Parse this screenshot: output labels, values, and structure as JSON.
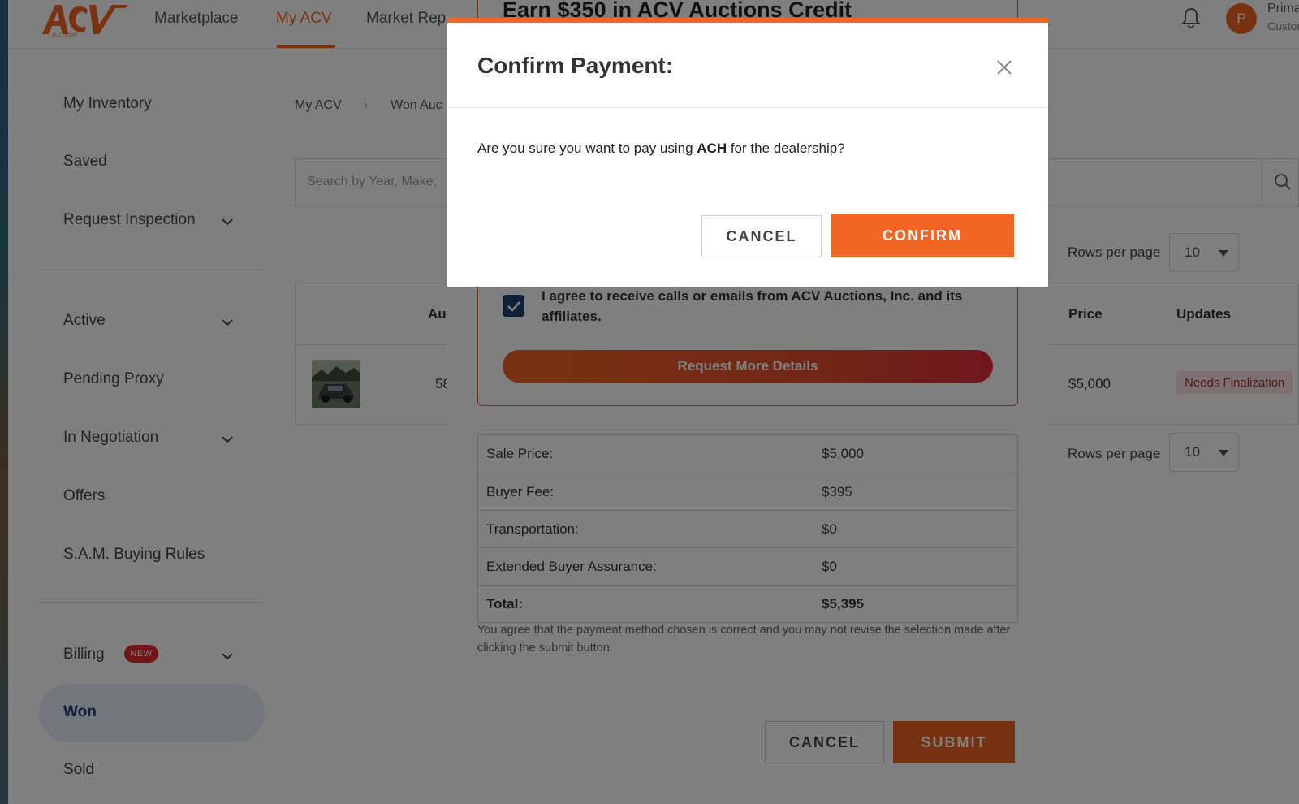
{
  "nav": {
    "links": [
      "Marketplace",
      "My ACV",
      "Market Rep"
    ],
    "user_initial": "P",
    "user_name": "Prima",
    "user_sub": "Custon"
  },
  "sidebar": {
    "items": [
      "My Inventory",
      "Saved",
      "Request Inspection",
      "Active",
      "Pending Proxy",
      "In Negotiation",
      "Offers",
      "S.A.M. Buying Rules",
      "Billing",
      "Won",
      "Sold"
    ],
    "billing_badge": "NEW"
  },
  "breadcrumb": [
    "My ACV",
    "Won Auc"
  ],
  "search": {
    "placeholder": "Search by Year, Make,"
  },
  "pagination": {
    "label": "Rows per page",
    "value": "10"
  },
  "table": {
    "headers": [
      "Auc",
      "Price",
      "Updates"
    ],
    "row": {
      "id_partial": "58",
      "price": "$5,000",
      "status": "Needs Finalization"
    }
  },
  "payment_modal": {
    "promo_title": "Earn $350 in ACV Auctions Credit",
    "agree_text": "I agree to receive calls or emails from ACV Auctions, Inc. and its affiliates.",
    "request_button": "Request More Details",
    "fees": [
      {
        "label": "Sale Price:",
        "value": "$5,000"
      },
      {
        "label": "Buyer Fee:",
        "value": "$395"
      },
      {
        "label": "Transportation:",
        "value": "$0"
      },
      {
        "label": "Extended Buyer Assurance:",
        "value": "$0"
      },
      {
        "label": "Total:",
        "value": "$5,395"
      }
    ],
    "fine_print": "You agree that the payment method chosen is correct and you may not revise the selection made after clicking the submit button.",
    "cancel": "CANCEL",
    "submit": "SUBMIT"
  },
  "confirm_dialog": {
    "title": "Confirm Payment:",
    "message_pre": "Are you sure you want to pay using ",
    "method": "ACH",
    "message_post": " for the dealership?",
    "cancel": "CANCEL",
    "confirm": "CONFIRM"
  },
  "colors": {
    "accent": "#f26522",
    "navy": "#1d3f6e",
    "alert": "#e32b2b"
  }
}
